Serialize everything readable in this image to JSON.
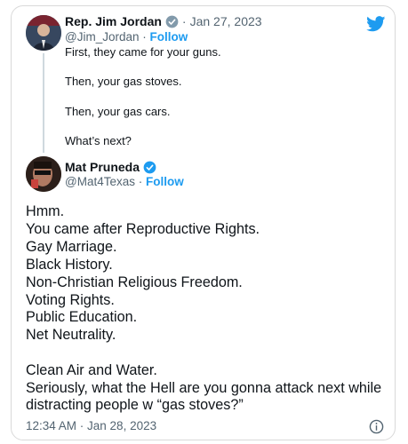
{
  "tweet_quoted": {
    "name": "Rep. Jim Jordan",
    "date": "Jan 27, 2023",
    "handle": "@Jim_Jordan",
    "follow_label": "Follow",
    "lines": [
      "First, they came for your guns.",
      "Then, your gas stoves.",
      "Then, your gas cars.",
      "What’s next?"
    ]
  },
  "tweet_main": {
    "name": "Mat Pruneda",
    "handle": "@Mat4Texas",
    "follow_label": "Follow",
    "lines": [
      "Hmm.",
      "You came after Reproductive Rights.",
      "Gay Marriage.",
      "Black History.",
      "Non-Christian Religious Freedom.",
      "Voting Rights.",
      "Public Education.",
      "Net Neutrality.",
      "Clean Air and Water.",
      "Seriously, what the Hell are you gonna attack next while",
      "distracting people w “gas stoves?”"
    ],
    "timestamp": "12:34 AM · Jan 28, 2023"
  },
  "icons": {
    "logo": "twitter-bird-icon",
    "verified": "verified-badge-icon",
    "info": "info-icon"
  },
  "colors": {
    "accent": "#1d9bf0",
    "muted": "#536471",
    "text": "#0f1419"
  }
}
